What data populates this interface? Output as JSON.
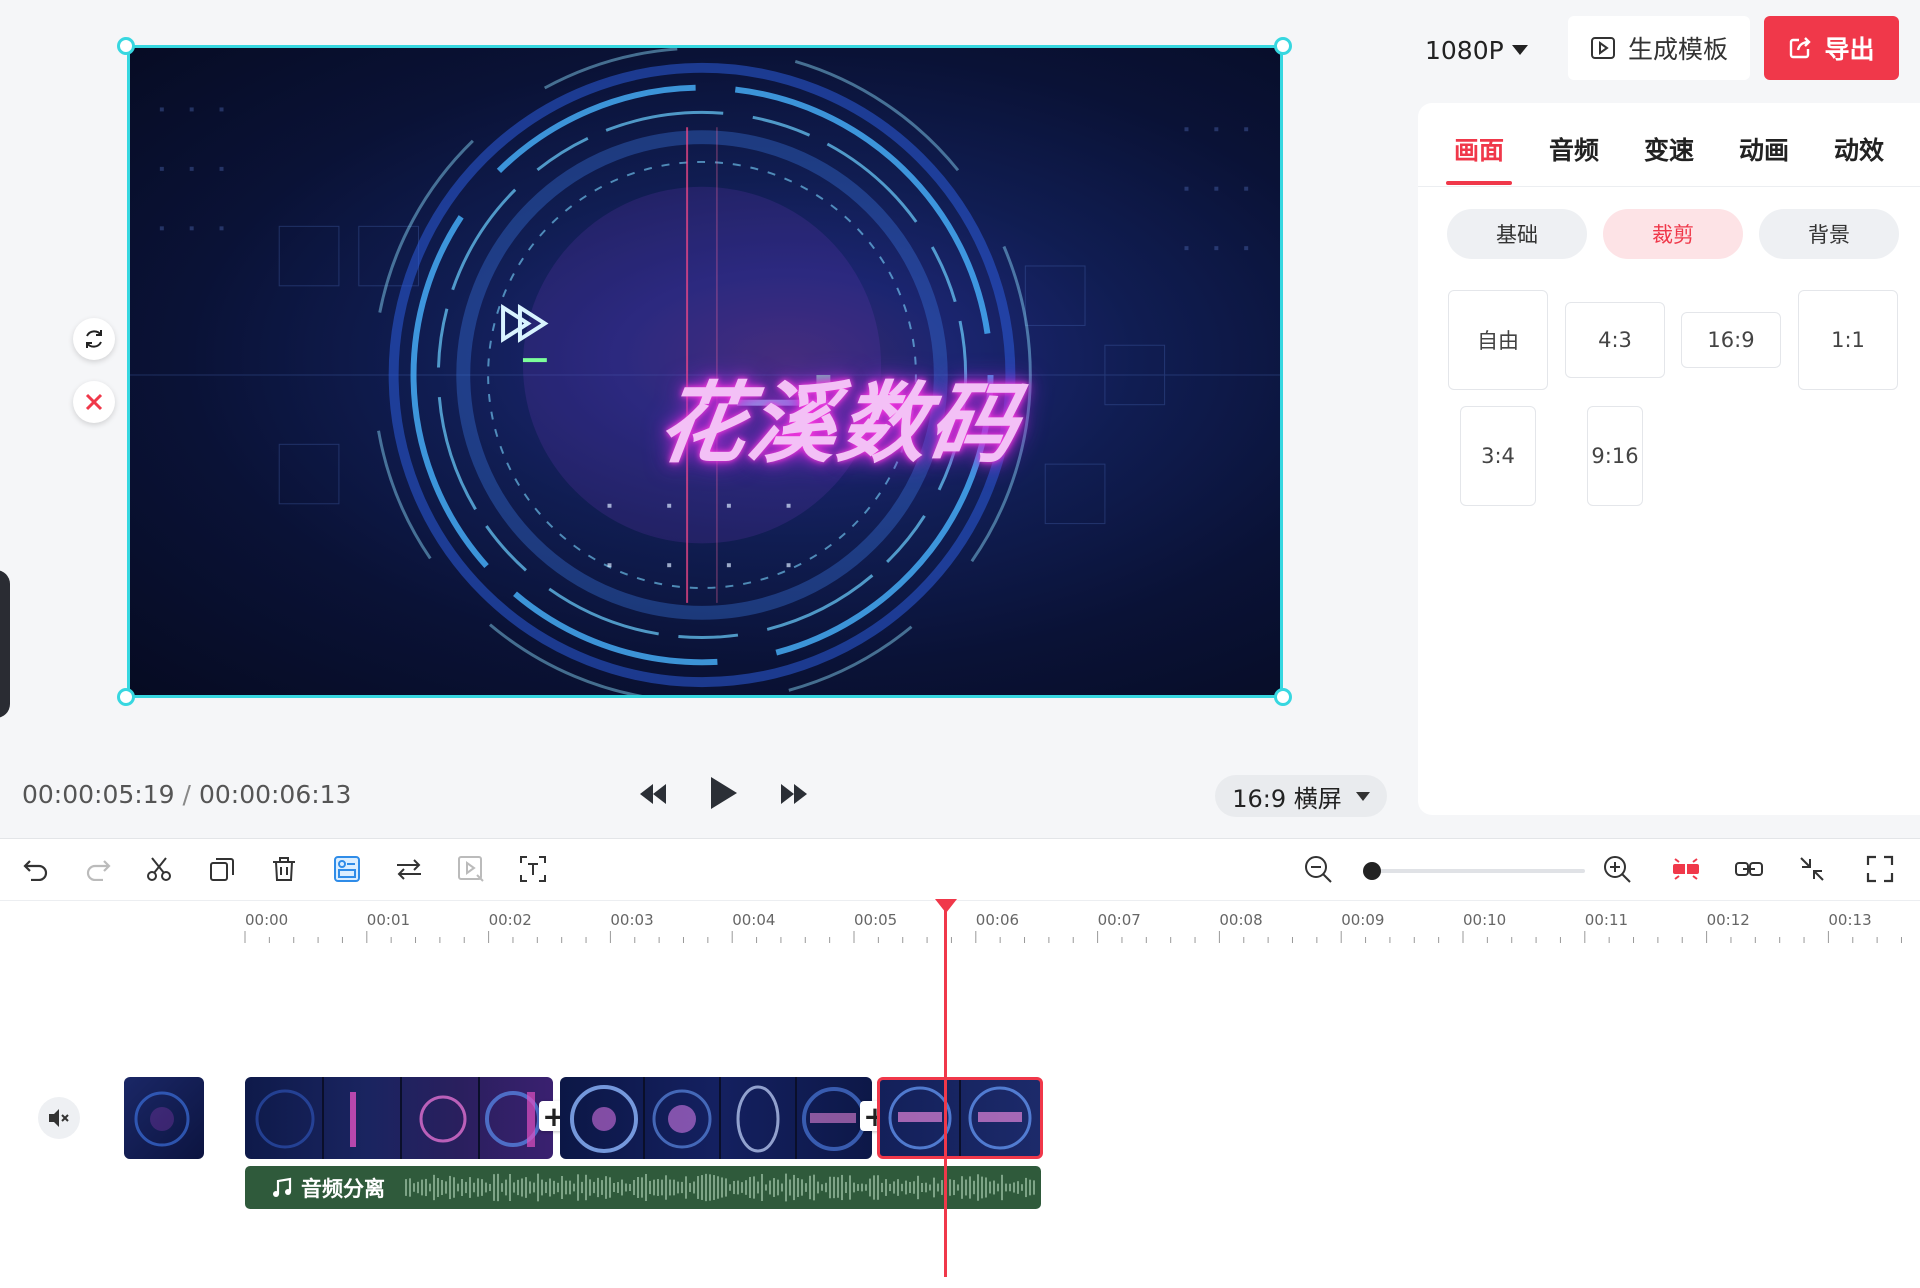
{
  "preview": {
    "title_text": "花溪数码",
    "side_buttons": [
      "refresh-icon",
      "close-icon"
    ]
  },
  "header": {
    "resolution": "1080P",
    "generate_template": "生成模板",
    "export": "导出"
  },
  "panel": {
    "tabs": [
      {
        "label": "画面",
        "active": true
      },
      {
        "label": "音频",
        "active": false
      },
      {
        "label": "变速",
        "active": false
      },
      {
        "label": "动画",
        "active": false
      },
      {
        "label": "动效",
        "active": false
      }
    ],
    "subtabs": [
      {
        "label": "基础",
        "active": false
      },
      {
        "label": "裁剪",
        "active": true
      },
      {
        "label": "背景",
        "active": false
      }
    ],
    "ratios": [
      "自由",
      "4:3",
      "16:9",
      "1:1",
      "3:4",
      "9:16"
    ]
  },
  "playback": {
    "current_time": "00:00:05:19",
    "separator": "/",
    "total_time": "00:00:06:13",
    "aspect": "16:9 横屏"
  },
  "timeline": {
    "ruler_labels": [
      "00:00",
      "00:01",
      "00:02",
      "00:03",
      "00:04",
      "00:05",
      "00:06",
      "00:07",
      "00:08",
      "00:09",
      "00:10",
      "00:11",
      "00:12",
      "00:13"
    ],
    "audio_label": "音频分离",
    "toolbar_icons": [
      "undo-icon",
      "redo-icon",
      "scissors-icon",
      "copy-icon",
      "delete-icon",
      "freeze-frame-icon",
      "swap-icon",
      "replace-icon",
      "crop-icon",
      "zoom-out-icon",
      "zoom-in-icon",
      "snap-icon",
      "link-icon",
      "collapse-icon",
      "fullscreen-icon"
    ]
  },
  "colors": {
    "accent": "#f0384a",
    "selection": "#37d7e0",
    "audio_track": "#2f5a3b"
  }
}
